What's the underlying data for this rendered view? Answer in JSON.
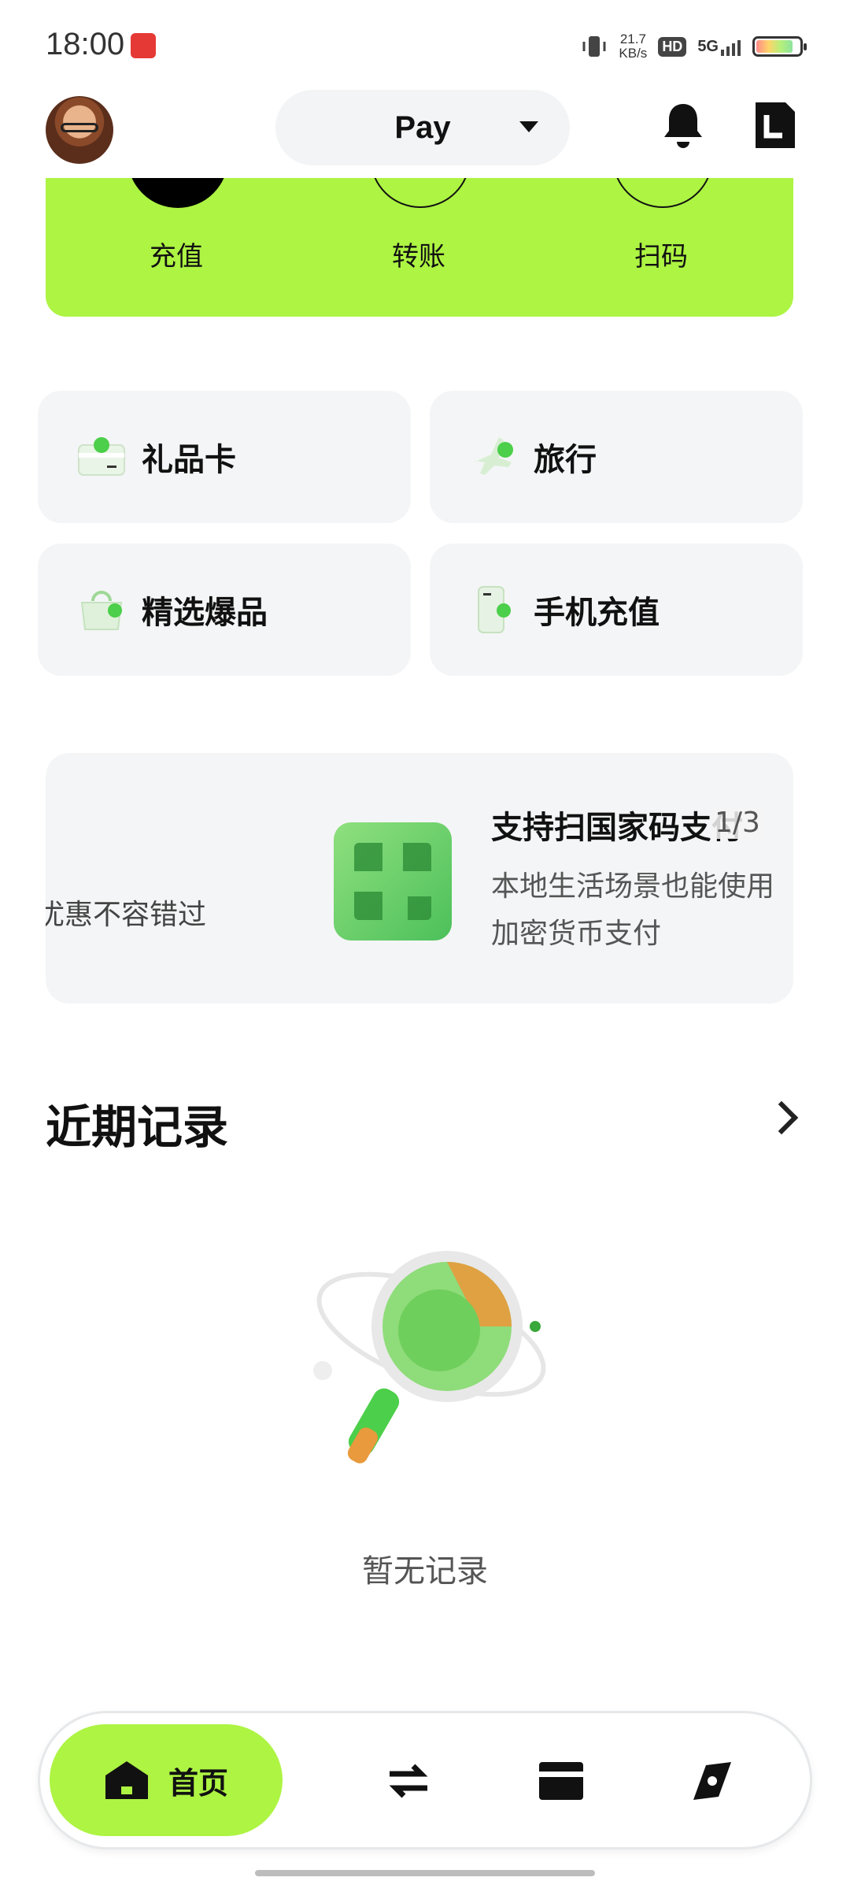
{
  "status_bar": {
    "time": "18:00",
    "net_speed_value": "21.7",
    "net_speed_unit": "KB/s",
    "hd_label": "HD",
    "network": "5G"
  },
  "header": {
    "pay_selector_label": "Pay"
  },
  "quick_actions": [
    {
      "label": "充值"
    },
    {
      "label": "转账"
    },
    {
      "label": "扫码"
    }
  ],
  "tiles": [
    {
      "label": "礼品卡",
      "icon": "gift-card-icon"
    },
    {
      "label": "旅行",
      "icon": "airplane-icon"
    },
    {
      "label": "精选爆品",
      "icon": "shopping-bag-icon"
    },
    {
      "label": "手机充值",
      "icon": "phone-topup-icon"
    }
  ],
  "banner": {
    "prev_slide_text": "优惠不容错过",
    "title": "支持扫国家码支付",
    "description_line1": "本地生活场景也能使用",
    "description_line2": "加密货币支付",
    "pager": "1/3"
  },
  "recent": {
    "title": "近期记录",
    "empty_text": "暂无记录"
  },
  "bottom_nav": {
    "home_label": "首页",
    "items": [
      "home-icon",
      "transfer-icon",
      "card-icon",
      "explore-icon"
    ]
  },
  "colors": {
    "accent_green": "#adf443",
    "tile_bg": "#f4f5f6"
  }
}
